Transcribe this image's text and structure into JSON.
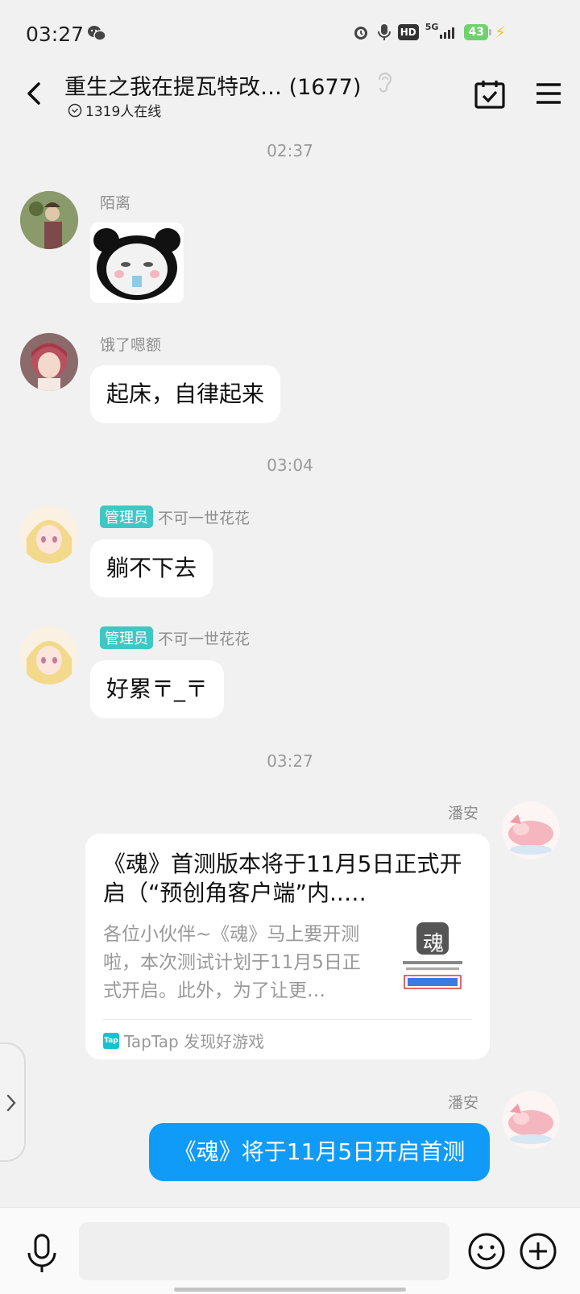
{
  "status_bar": {
    "time": "03:27",
    "network": "5G",
    "hd": "HD",
    "battery": "43",
    "icons": [
      "wechat-icon",
      "alarm-icon",
      "mic-icon",
      "hd-icon",
      "signal-icon",
      "battery-icon",
      "charging-icon"
    ]
  },
  "header": {
    "title": "重生之我在提瓦特改… (1677)",
    "online": "1319人在线",
    "icons": [
      "back-arrow-icon",
      "ear-icon",
      "calendar-check-icon",
      "menu-icon"
    ]
  },
  "messages": {
    "ts1": "02:37",
    "m1_sender": "陌离",
    "m2_sender": "饿了嗯额",
    "m2_text": "起床，自律起来",
    "ts2": "03:04",
    "admin_tag": "管理员",
    "m3_sender": "不可一世花花",
    "m3_text": "躺不下去",
    "m4_sender": "不可一世花花",
    "m4_text": "好累〒_〒",
    "ts3": "03:27",
    "m5_sender": "潘安",
    "m6_sender": "潘安",
    "m6_text": "《魂》将于11月5日开启首测"
  },
  "link_card": {
    "title": "《魂》首测版本将于11月5日正式开启（“预创角客户端”内..…",
    "description": "各位小伙伴~《魂》马上要开测啦，本次测试计划于11月5日正式开启。此外，为了让更…",
    "source": "TapTap 发现好游戏",
    "thumb_char": "魂",
    "tap_logo": "Tap"
  },
  "input": {
    "value": "",
    "placeholder": ""
  },
  "colors": {
    "accent_blue": "#0f9bf7",
    "admin_tag": "#3fc7c4",
    "background": "#f1f1f1"
  }
}
